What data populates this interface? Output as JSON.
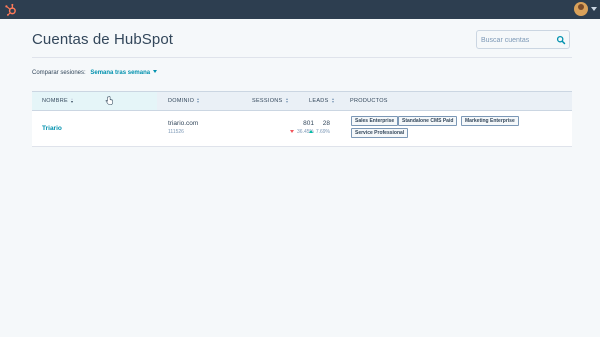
{
  "topbar": {
    "logo_icon": "hubspot-sprocket-icon",
    "avatar_icon": "user-avatar",
    "menu_icon": "chevron-down-icon"
  },
  "page": {
    "title": "Cuentas de HubSpot"
  },
  "search": {
    "placeholder": "Buscar cuentas",
    "value": "",
    "icon": "search-icon"
  },
  "compare": {
    "label": "Comparar sesiones:",
    "value": "Semana tras semana"
  },
  "table": {
    "columns": [
      {
        "label": "NOMBRE",
        "sorted": true
      },
      {
        "label": "DOMINIO",
        "sorted": false
      },
      {
        "label": "SESSIONS",
        "sorted": false
      },
      {
        "label": "LEADS",
        "sorted": false
      },
      {
        "label": "PRODUCTOS",
        "sorted": false
      }
    ],
    "rows": [
      {
        "name": "Triario",
        "domain": "triario.com",
        "portal_id": "111526",
        "sessions": "801",
        "sessions_change": "36.45%",
        "sessions_trend": "down",
        "leads": "28",
        "leads_change": "7.69%",
        "leads_trend": "up",
        "products": [
          "Sales Enterprise",
          "Standalone CMS Paid",
          "Marketing Enterprise",
          "Service Professional"
        ]
      }
    ]
  },
  "colors": {
    "topbar": "#2d3e50",
    "link": "#0091ae",
    "text": "#33475b",
    "down": "#f2545b",
    "up": "#00bda5",
    "header_bg": "#eaf0f6",
    "active_header_bg": "#e5f5f8"
  }
}
